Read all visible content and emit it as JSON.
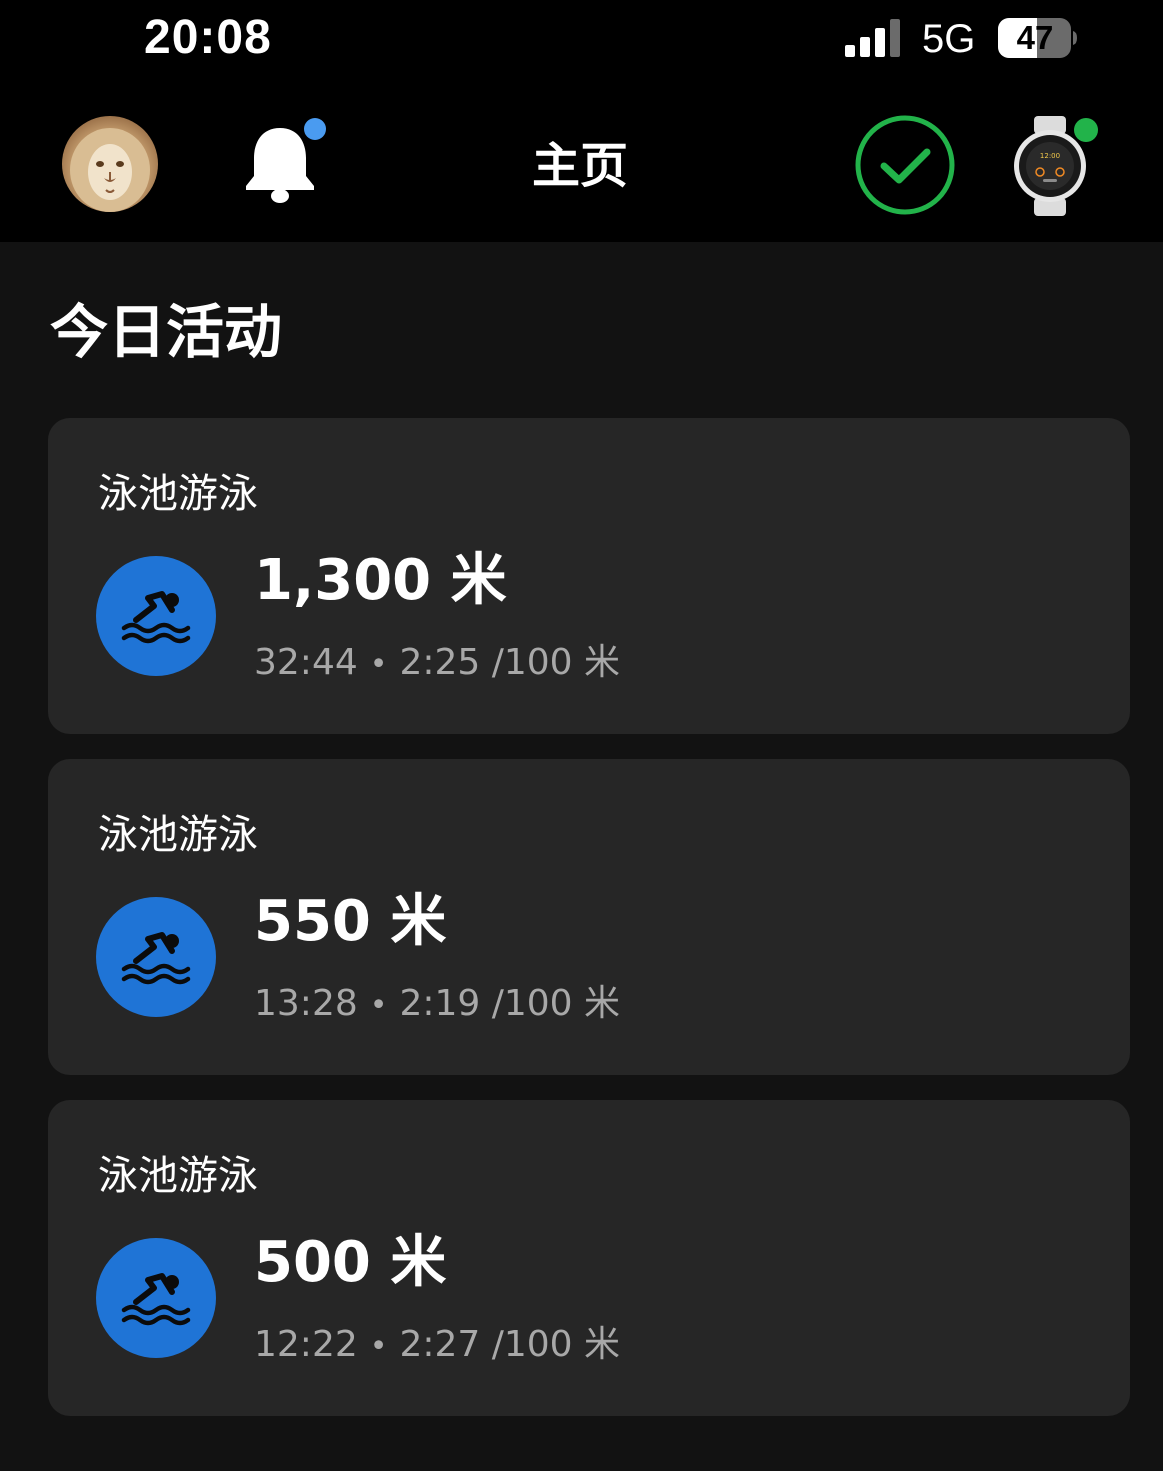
{
  "status_bar": {
    "time": "20:08",
    "network": "5G",
    "battery": "47"
  },
  "header": {
    "title": "主页",
    "icons": {
      "avatar": "lion-avatar",
      "notifications": "bell-icon",
      "sync": "checkmark-circle-icon",
      "device": "watch-icon"
    },
    "colors": {
      "notification_dot": "#4a9bf0",
      "sync_ok": "#22b34a",
      "device_dot": "#22b34a"
    }
  },
  "section": {
    "title": "今日活动"
  },
  "activities": [
    {
      "type": "泳池游泳",
      "distance": "1,300 米",
      "duration": "32:44",
      "separator": "•",
      "pace": "2:25 /100 米"
    },
    {
      "type": "泳池游泳",
      "distance": "550 米",
      "duration": "13:28",
      "separator": "•",
      "pace": "2:19 /100 米"
    },
    {
      "type": "泳池游泳",
      "distance": "500 米",
      "duration": "12:22",
      "separator": "•",
      "pace": "2:27 /100 米"
    }
  ],
  "activity_icon": "swimming-icon",
  "accent_color": "#1f74d6"
}
